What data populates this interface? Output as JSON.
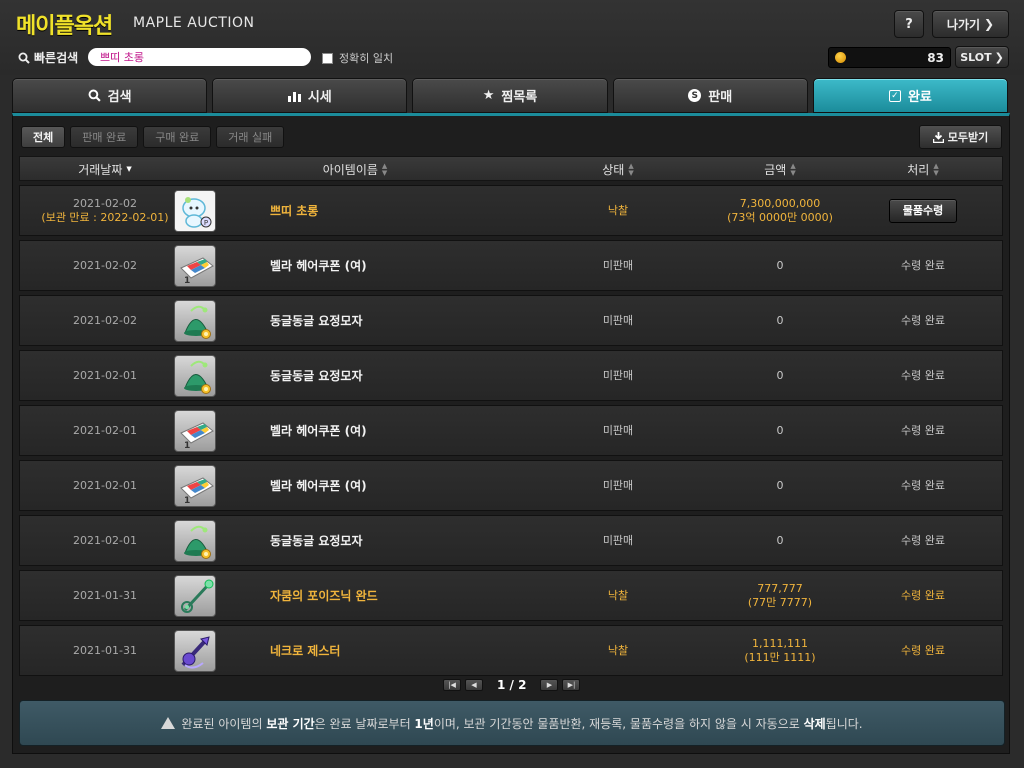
{
  "header": {
    "title_ko": "메이플옥션",
    "title_en": "MAPLE AUCTION",
    "help_label": "?",
    "exit_label": "나가기",
    "search_label": "빠른검색",
    "search_value": "쁘띠 초롱",
    "exact_match_label": "정확히 일치",
    "coin_value": "83",
    "slot_label": "SLOT"
  },
  "tabs": [
    {
      "label": "검색",
      "icon": "search-icon"
    },
    {
      "label": "시세",
      "icon": "bar-chart-icon"
    },
    {
      "label": "찜목록",
      "icon": "star-icon"
    },
    {
      "label": "판매",
      "icon": "sell-coin-icon"
    },
    {
      "label": "완료",
      "icon": "check-icon",
      "active": true
    }
  ],
  "filters": [
    "전체",
    "판매 완료",
    "구매 완료",
    "거래 실패"
  ],
  "receive_all_label": "모두받기",
  "table": {
    "columns": [
      "거래날짜",
      "아이템이름",
      "상태",
      "금액",
      "처리"
    ],
    "rows": [
      {
        "date": "2021-02-02",
        "date_sub": "(보관 만료 : 2022-02-01)",
        "icon": "petit-lantern-icon",
        "name": "쁘띠 초롱",
        "status": "낙찰",
        "amount": "7,300,000,000",
        "amount_sub": "(73억 0000만 0000)",
        "action": "물품수령",
        "highlight": true
      },
      {
        "date": "2021-02-02",
        "icon": "hair-coupon-icon",
        "name": "벨라 헤어쿠폰 (여)",
        "status": "미판매",
        "amount": "0",
        "action": "수령 완료"
      },
      {
        "date": "2021-02-02",
        "icon": "fairy-hat-icon",
        "name": "동글동글 요정모자",
        "status": "미판매",
        "amount": "0",
        "action": "수령 완료"
      },
      {
        "date": "2021-02-01",
        "icon": "fairy-hat-icon",
        "name": "동글동글 요정모자",
        "status": "미판매",
        "amount": "0",
        "action": "수령 완료"
      },
      {
        "date": "2021-02-01",
        "icon": "hair-coupon-icon",
        "name": "벨라 헤어쿠폰 (여)",
        "status": "미판매",
        "amount": "0",
        "action": "수령 완료"
      },
      {
        "date": "2021-02-01",
        "icon": "hair-coupon-icon",
        "name": "벨라 헤어쿠폰 (여)",
        "status": "미판매",
        "amount": "0",
        "action": "수령 완료"
      },
      {
        "date": "2021-02-01",
        "icon": "fairy-hat-icon",
        "name": "동글동글 요정모자",
        "status": "미판매",
        "amount": "0",
        "action": "수령 완료"
      },
      {
        "date": "2021-01-31",
        "icon": "wand-icon",
        "name": "자쿰의 포이즈닉 완드",
        "status": "낙찰",
        "amount": "777,777",
        "amount_sub": "(77만 7777)",
        "action": "수령 완료",
        "highlight": true
      },
      {
        "date": "2021-01-31",
        "icon": "necro-jester-icon",
        "name": "네크로 제스터",
        "status": "낙찰",
        "amount": "1,111,111",
        "amount_sub": "(111만 1111)",
        "action": "수령 완료",
        "highlight": true
      }
    ]
  },
  "pagination": {
    "text": "1 / 2"
  },
  "notice": {
    "t1": "완료된 아이템의 ",
    "b1": "보관 기간",
    "t2": "은 완료 날짜로부터 ",
    "b2": "1년",
    "t3": "이며, 보관 기간동안 물품반환, 재등록, 물품수령을 하지 않을 시 자동으로 ",
    "b3": "삭제",
    "t4": "됩니다."
  },
  "colors": {
    "accent": "#1b8c9b",
    "gold": "#f0b43c",
    "brand_yellow": "#f0e22a"
  }
}
